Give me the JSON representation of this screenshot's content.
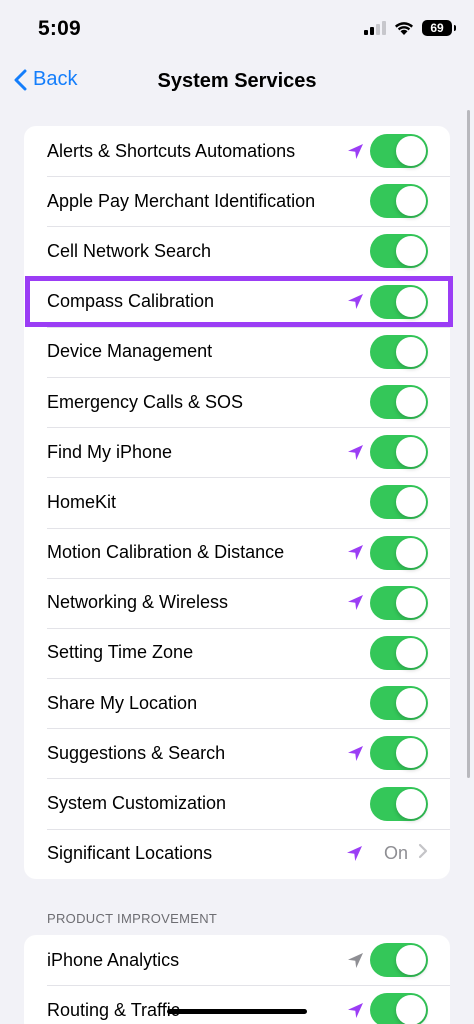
{
  "status_bar": {
    "time": "5:09",
    "battery": "69"
  },
  "nav": {
    "back_label": "Back",
    "title": "System Services"
  },
  "colors": {
    "accent": "#147efb",
    "toggle_on": "#34c759",
    "location_arrow_purple": "#9b3df5",
    "location_arrow_gray": "#8e8e93",
    "highlight": "#9b3df5"
  },
  "services": [
    {
      "label": "Alerts & Shortcuts Automations",
      "location_icon": "purple",
      "toggle": true
    },
    {
      "label": "Apple Pay Merchant Identification",
      "location_icon": "none",
      "toggle": true
    },
    {
      "label": "Cell Network Search",
      "location_icon": "none",
      "toggle": true
    },
    {
      "label": "Compass Calibration",
      "location_icon": "purple",
      "toggle": true,
      "highlighted": true
    },
    {
      "label": "Device Management",
      "location_icon": "none",
      "toggle": true
    },
    {
      "label": "Emergency Calls & SOS",
      "location_icon": "none",
      "toggle": true
    },
    {
      "label": "Find My iPhone",
      "location_icon": "purple",
      "toggle": true
    },
    {
      "label": "HomeKit",
      "location_icon": "none",
      "toggle": true
    },
    {
      "label": "Motion Calibration & Distance",
      "location_icon": "purple",
      "toggle": true
    },
    {
      "label": "Networking & Wireless",
      "location_icon": "purple",
      "toggle": true
    },
    {
      "label": "Setting Time Zone",
      "location_icon": "none",
      "toggle": true
    },
    {
      "label": "Share My Location",
      "location_icon": "none",
      "toggle": true
    },
    {
      "label": "Suggestions & Search",
      "location_icon": "purple",
      "toggle": true
    },
    {
      "label": "System Customization",
      "location_icon": "none",
      "toggle": true
    },
    {
      "label": "Significant Locations",
      "location_icon": "purple",
      "toggle": false,
      "value": "On"
    }
  ],
  "product_improvement": {
    "header": "PRODUCT IMPROVEMENT",
    "items": [
      {
        "label": "iPhone Analytics",
        "location_icon": "gray",
        "toggle": true
      },
      {
        "label": "Routing & Traffic",
        "location_icon": "purple",
        "toggle": true
      }
    ]
  }
}
